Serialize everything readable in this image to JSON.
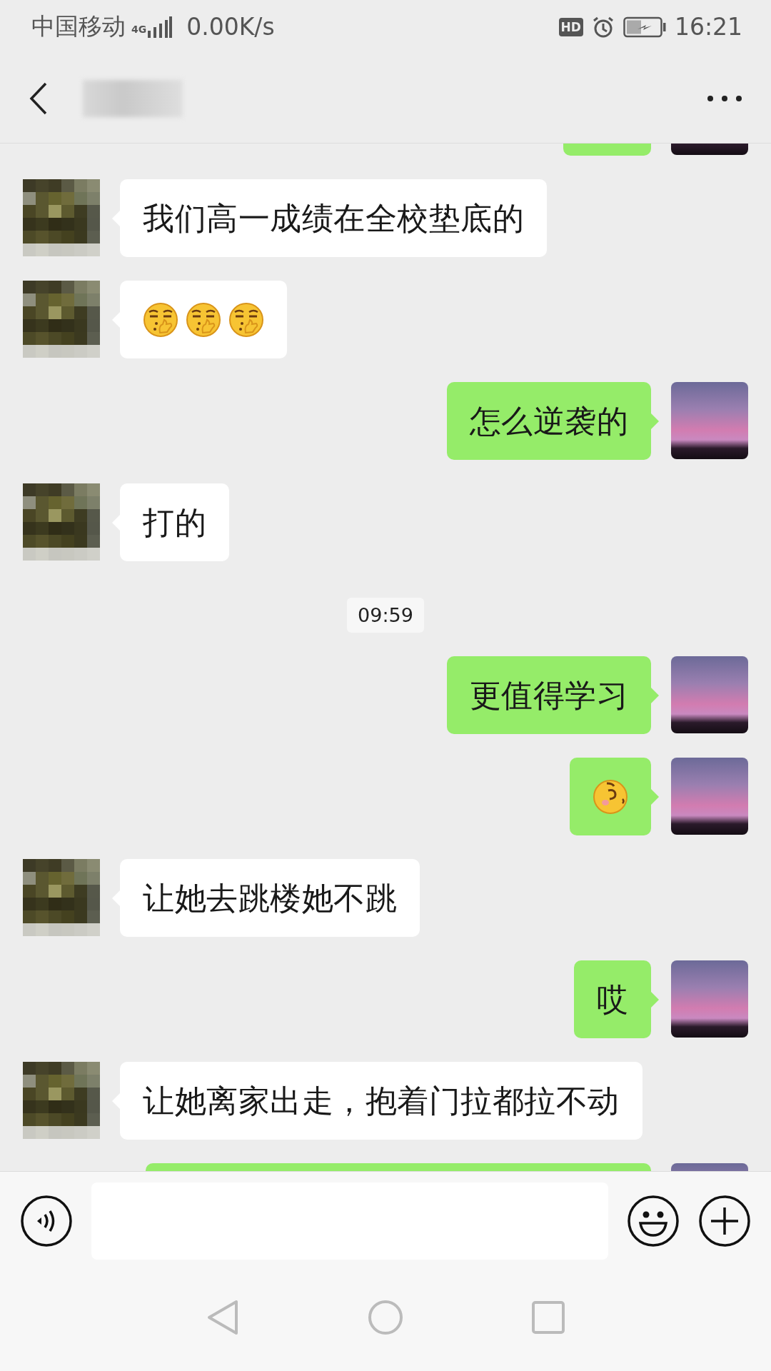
{
  "status_bar": {
    "carrier": "中国移动",
    "network": "4G",
    "speed": "0.00K/s",
    "hd_badge": "HD",
    "time": "16:21"
  },
  "messages": [
    {
      "from_me": true,
      "kind": "partial",
      "wide": false
    },
    {
      "from_me": false,
      "kind": "text",
      "text": "我们高一成绩在全校垫底的"
    },
    {
      "from_me": false,
      "kind": "emoji",
      "emojis": [
        {
          "kind": "hand"
        },
        {
          "kind": "hand"
        },
        {
          "kind": "hand"
        }
      ]
    },
    {
      "from_me": true,
      "kind": "text",
      "text": "怎么逆袭的"
    },
    {
      "from_me": false,
      "kind": "text",
      "text": "打的"
    },
    {
      "kind": "time",
      "text": "09:59"
    },
    {
      "from_me": true,
      "kind": "text",
      "text": "更值得学习"
    },
    {
      "from_me": true,
      "kind": "emoji",
      "emojis": [
        {
          "kind": "sleepy"
        }
      ]
    },
    {
      "from_me": false,
      "kind": "text",
      "text": "让她去跳楼她不跳"
    },
    {
      "from_me": true,
      "kind": "text",
      "text": "哎"
    },
    {
      "from_me": false,
      "kind": "text",
      "text": "让她离家出走，抱着门拉都拉不动"
    },
    {
      "from_me": true,
      "kind": "partial",
      "wide": true
    }
  ]
}
